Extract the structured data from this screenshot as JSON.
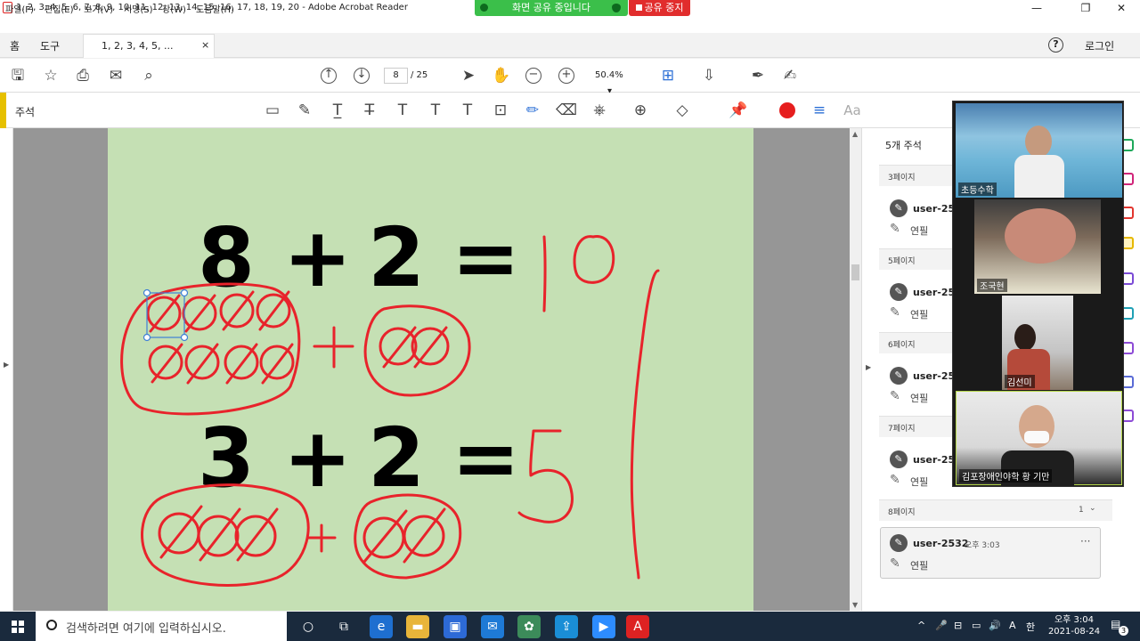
{
  "window": {
    "title": "1,   2,   3,   4,   5, 6,   7,   8,   9,   10,  11,  12,  13,  14,  15, 16,  17,  18,  19,  20 - Adobe Acrobat Reader",
    "minimize": "—",
    "restore": "❐",
    "close": "✕"
  },
  "share": {
    "banner": "화면 공유 중입니다",
    "stop": "공유 중지",
    "banner_color": "#3bbf4a",
    "stop_color": "#e12d2d"
  },
  "menu": [
    "파일(F)",
    "편집(E)",
    "보기(V)",
    "서명(S)",
    "창(W)",
    "도움말(H)"
  ],
  "tabs": {
    "home": "홈",
    "tools": "도구",
    "document": "1,   2,   3,   4,   5, ...",
    "close": "×",
    "login": "로그인",
    "help": "?"
  },
  "toolbar": {
    "page_current": "8",
    "page_total": "/ 25",
    "zoom": "50.4%"
  },
  "comment_bar": {
    "title": "주석"
  },
  "page_content": {
    "eq1_a": "8",
    "eq1_op": "+",
    "eq1_b": "2",
    "eq1_eq": "=",
    "eq2_a": "3",
    "eq2_op": "+",
    "eq2_b": "2",
    "eq2_eq": "="
  },
  "comments_panel": {
    "title": "5개 주석",
    "groups": [
      {
        "page": "3페이지",
        "user": "user-253",
        "text": "연필"
      },
      {
        "page": "5페이지",
        "user": "user-253",
        "text": "연필"
      },
      {
        "page": "6페이지",
        "user": "user-253",
        "text": "연필"
      },
      {
        "page": "7페이지",
        "user": "user-253",
        "text": "연필"
      },
      {
        "page": "8페이지",
        "user": "user-2532",
        "time": "오후 3:03",
        "text": "연필",
        "count": "1"
      }
    ]
  },
  "video": {
    "participants": [
      "초등수학",
      "조국현",
      "김선미",
      "김포장애인야학  황 기만"
    ]
  },
  "taskbar": {
    "search_placeholder": "검색하려면 여기에 입력하십시오.",
    "time": "오후 3:04",
    "date": "2021-08-24",
    "ime": "한",
    "notifications": "3"
  }
}
